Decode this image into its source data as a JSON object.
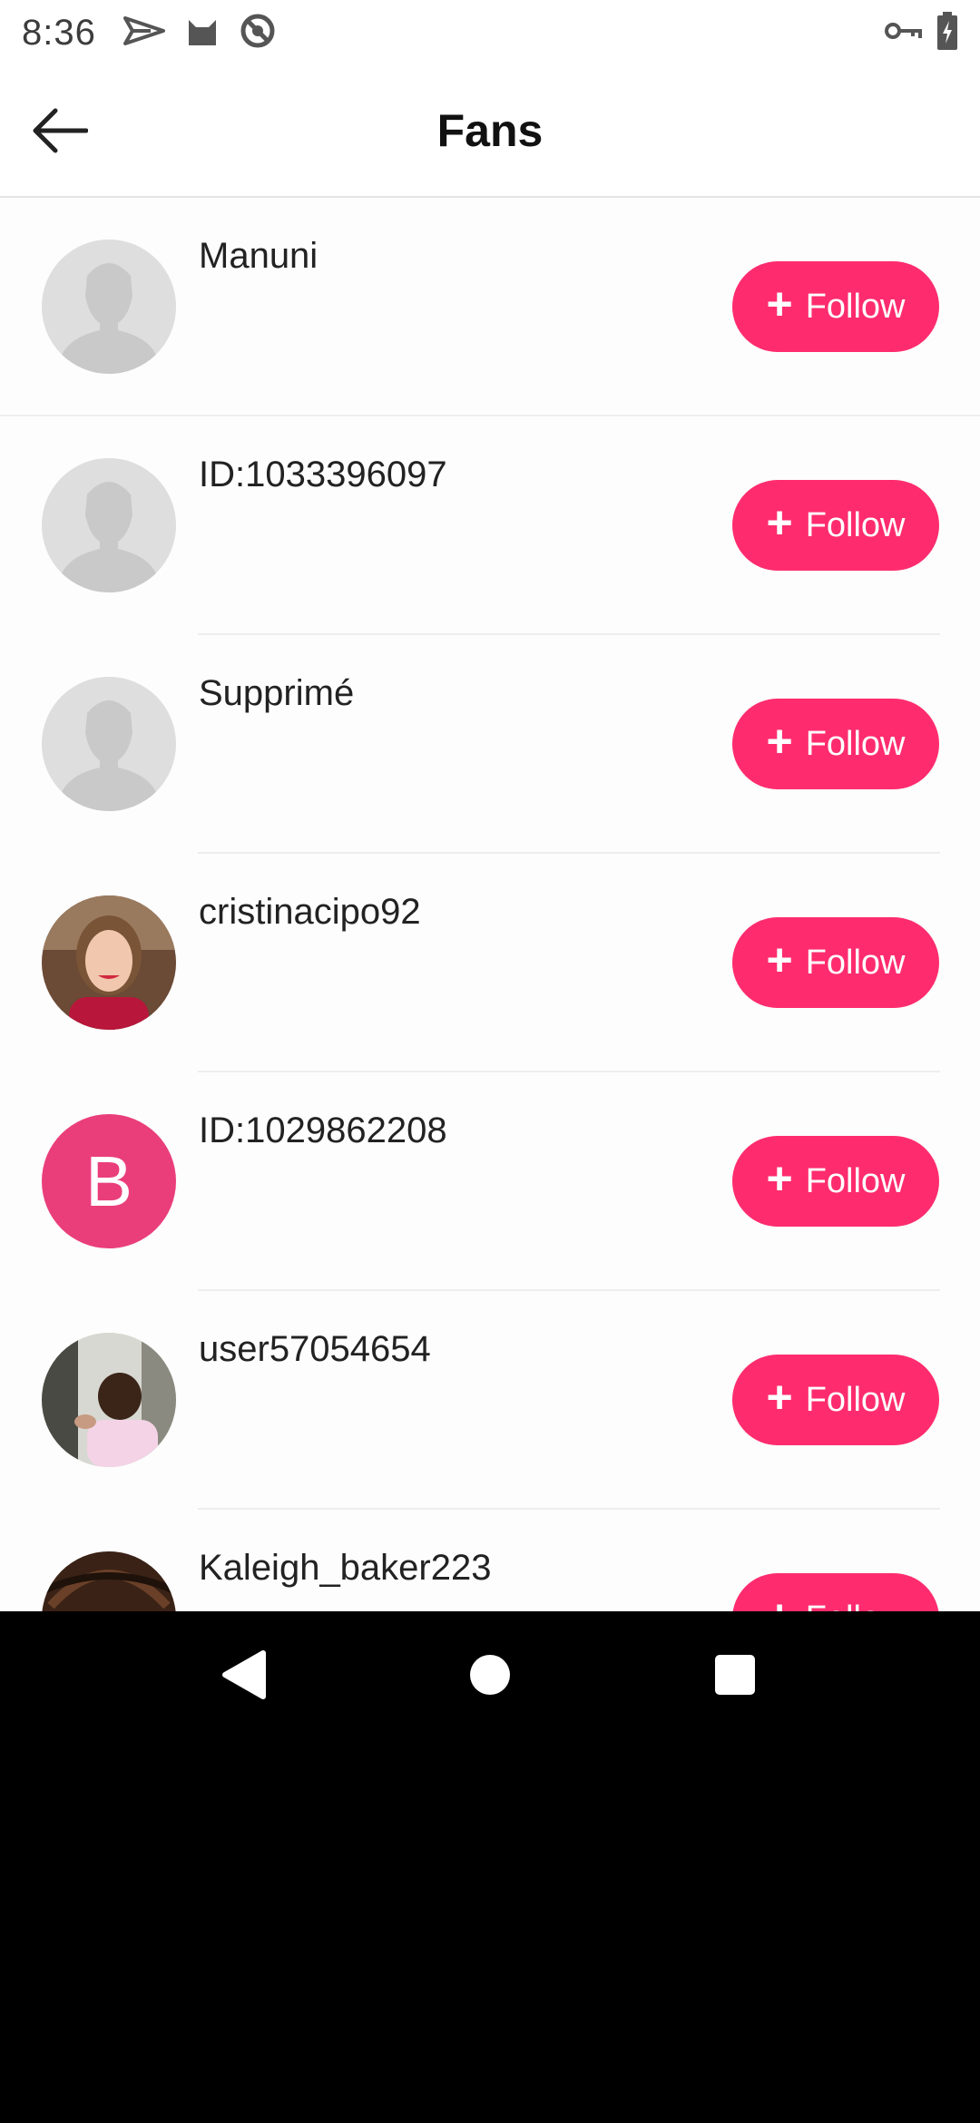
{
  "status_bar": {
    "time": "8:36",
    "icons_left": [
      "send-icon",
      "cat-icon",
      "no-tracking-icon"
    ],
    "icons_right": [
      "key-icon",
      "battery-charging-icon"
    ]
  },
  "header": {
    "title": "Fans",
    "back_icon": "arrow-left-icon"
  },
  "fans": [
    {
      "name": "Manuni",
      "avatar": "placeholder",
      "button": {
        "plus": "+",
        "label": "Follow"
      }
    },
    {
      "name": "ID:1033396097",
      "avatar": "placeholder",
      "button": {
        "plus": "+",
        "label": "Follow"
      }
    },
    {
      "name": "Supprimé",
      "avatar": "placeholder",
      "button": {
        "plus": "+",
        "label": "Follow"
      }
    },
    {
      "name": "cristinacipo92",
      "avatar": "photo",
      "button": {
        "plus": "+",
        "label": "Follow"
      }
    },
    {
      "name": "ID:1029862208",
      "avatar": "letter",
      "avatar_letter": "B",
      "button": {
        "plus": "+",
        "label": "Follow"
      }
    },
    {
      "name": "user57054654",
      "avatar": "photo",
      "button": {
        "plus": "+",
        "label": "Follow"
      }
    },
    {
      "name": "Kaleigh_baker223",
      "avatar": "photo",
      "button": {
        "plus": "+",
        "label": "Follow"
      }
    }
  ],
  "colors": {
    "accent": "#fe2c6e",
    "letter_avatar": "#ea3e7b",
    "placeholder_avatar": "#dedede"
  },
  "nav_bar": {
    "icons": [
      "back-triangle-icon",
      "home-circle-icon",
      "recents-square-icon"
    ]
  }
}
